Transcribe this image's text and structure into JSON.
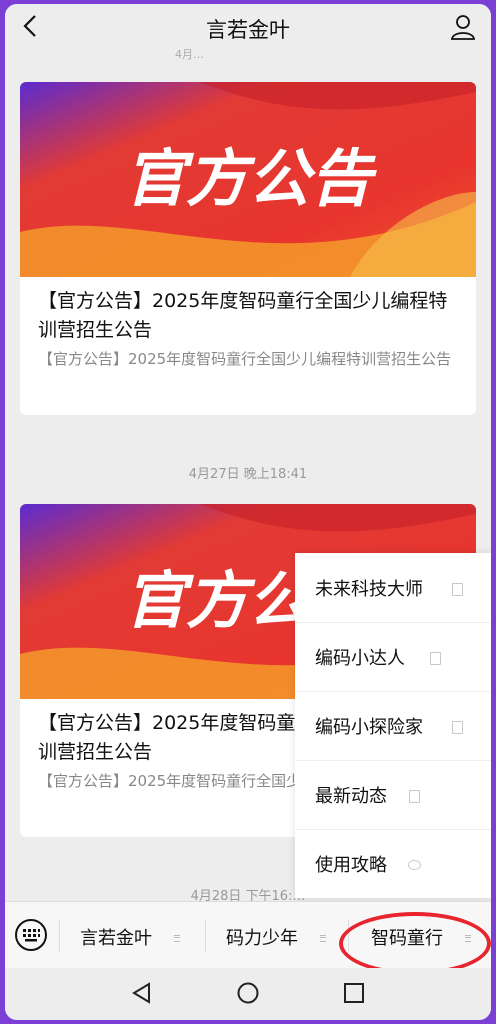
{
  "header": {
    "title": "言若金叶",
    "peek_text": "4月…"
  },
  "cards": [
    {
      "banner_text": "官方公告",
      "title": "【官方公告】2025年度智码童行全国少儿编程特训营招生公告",
      "desc": "【官方公告】2025年度智码童行全国少儿编程特训营招生公告"
    },
    {
      "banner_text": "官方公告",
      "title": "【官方公告】2025年度智码童行全国少儿编程特训营招生公告",
      "desc": "【官方公告】2025年度智码童行全国少儿编程特训营招生公告"
    }
  ],
  "timestamps": [
    "4月27日 晚上18:41",
    "4月28日 下午16:…"
  ],
  "popup_menu": {
    "items": [
      {
        "label": "未来科技大师",
        "icon": "doc-icon"
      },
      {
        "label": "编码小达人",
        "icon": "doc-icon"
      },
      {
        "label": "编码小探险家",
        "icon": "doc-icon"
      },
      {
        "label": "最新动态",
        "icon": "doc-icon"
      },
      {
        "label": "使用攻略",
        "icon": "chat-bubble-icon"
      }
    ]
  },
  "tabbar": {
    "tabs": [
      {
        "label": "言若金叶"
      },
      {
        "label": "码力少年"
      },
      {
        "label": "智码童行"
      }
    ]
  },
  "colors": {
    "annotation_circle": "#e8242e",
    "frame": "#7b3fd6",
    "banner_red": "#e8352e"
  }
}
